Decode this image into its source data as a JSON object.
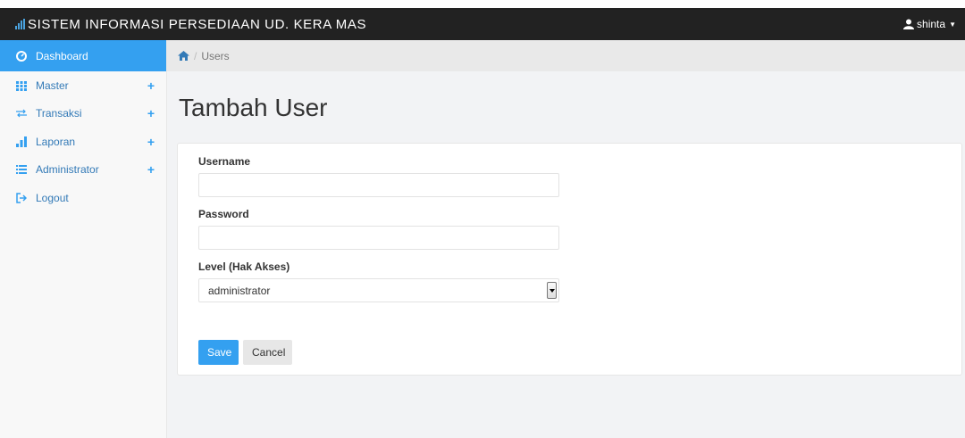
{
  "app": {
    "title": "SISTEM INFORMASI PERSEDIAAN UD. KERA MAS",
    "user": "shinta"
  },
  "sidebar": {
    "items": [
      {
        "label": "Dashboard",
        "icon": "dashboard-icon",
        "expandable": false,
        "active": true
      },
      {
        "label": "Master",
        "icon": "grid-icon",
        "expandable": true,
        "active": false
      },
      {
        "label": "Transaksi",
        "icon": "exchange-icon",
        "expandable": true,
        "active": false
      },
      {
        "label": "Laporan",
        "icon": "bar-chart-icon",
        "expandable": true,
        "active": false
      },
      {
        "label": "Administrator",
        "icon": "list-icon",
        "expandable": true,
        "active": false
      },
      {
        "label": "Logout",
        "icon": "logout-icon",
        "expandable": false,
        "active": false
      }
    ],
    "expand_glyph": "+"
  },
  "breadcrumb": {
    "separator": "/",
    "current": "Users"
  },
  "page": {
    "title": "Tambah User"
  },
  "form": {
    "username_label": "Username",
    "username_value": "",
    "password_label": "Password",
    "password_value": "",
    "level_label": "Level (Hak Akses)",
    "level_selected": "administrator",
    "save_label": "Save",
    "cancel_label": "Cancel"
  },
  "colors": {
    "topbar": "#222222",
    "accent": "#34a0f0",
    "link": "#337ab7"
  }
}
